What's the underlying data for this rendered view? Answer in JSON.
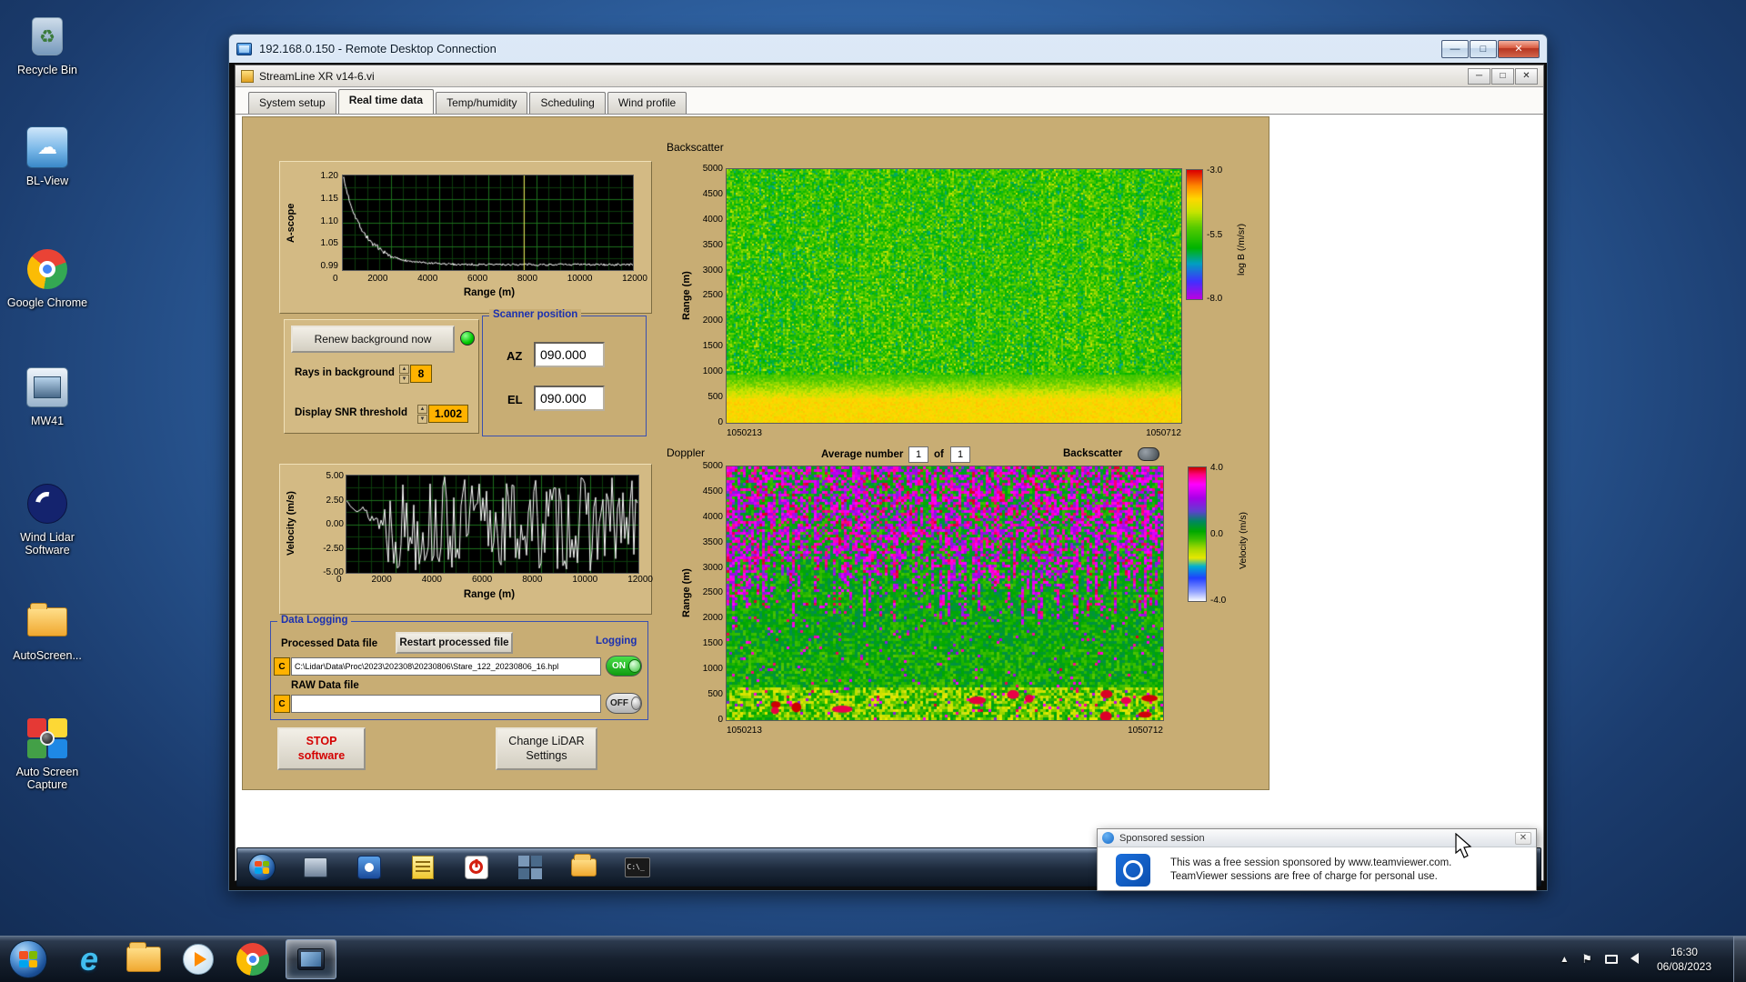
{
  "desktop": {
    "icons": [
      {
        "label": "Recycle Bin"
      },
      {
        "label": "BL-View"
      },
      {
        "label": "Google Chrome"
      },
      {
        "label": "MW41"
      },
      {
        "label": "Wind Lidar Software"
      },
      {
        "label": "AutoScreen..."
      },
      {
        "label": "Auto Screen Capture"
      }
    ]
  },
  "rdp": {
    "title": "192.168.0.150 - Remote Desktop Connection"
  },
  "app": {
    "title": "StreamLine XR v14-6.vi",
    "tabs": [
      "System setup",
      "Real time data",
      "Temp/humidity",
      "Scheduling",
      "Wind profile"
    ],
    "active_tab": "Real time data"
  },
  "panel": {
    "renew_button": "Renew background now",
    "rays_label": "Rays in background",
    "rays_value": "8",
    "snr_label": "Display SNR threshold",
    "snr_value": "1.002",
    "scanner": {
      "title": "Scanner position",
      "az_label": "AZ",
      "az_value": "090.000",
      "el_label": "EL",
      "el_value": "090.000"
    },
    "doppler_bar": {
      "avg_label": "Average number",
      "avg_value": "1",
      "of_label": "of",
      "of_value": "1",
      "backscatter_label": "Backscatter"
    },
    "logging": {
      "title": "Data Logging",
      "processed_label": "Processed Data file",
      "restart_button": "Restart processed file",
      "logging_label": "Logging",
      "drive": "C",
      "processed_path": "C:\\Lidar\\Data\\Proc\\2023\\202308\\20230806\\Stare_122_20230806_16.hpl",
      "on": "ON",
      "raw_label": "RAW Data file",
      "raw_path": "",
      "off": "OFF"
    },
    "stop_line1": "STOP",
    "stop_line2": "software",
    "settings_line1": "Change LiDAR",
    "settings_line2": "Settings"
  },
  "teamviewer": {
    "title": "Sponsored session",
    "line1": "This was a free session sponsored by www.teamviewer.com.",
    "line2": "TeamViewer sessions are free of charge for personal use."
  },
  "tray": {
    "time": "16:30",
    "date": "06/08/2023"
  },
  "chart_data": [
    {
      "id": "ascope",
      "type": "line",
      "xlabel": "Range (m)",
      "ylabel": "A-scope",
      "xlim": [
        0,
        12000
      ],
      "ylim": [
        0.99,
        1.2
      ],
      "xticks": [
        "0",
        "2000",
        "4000",
        "6000",
        "8000",
        "10000",
        "12000"
      ],
      "yticks": [
        1.2,
        1.15,
        1.1,
        1.05,
        0.99
      ],
      "ytick_labels": [
        "1.20",
        "1.15",
        "1.10",
        "1.05",
        "0.99"
      ],
      "line_color": "#ffffff",
      "cursor_x": 7500,
      "cursor_color": "#f8f860",
      "decay": {
        "start": 1.2,
        "base": 1.002,
        "tau_m": 850,
        "noise": 0.005
      }
    },
    {
      "id": "backscatter",
      "type": "heatmap",
      "title": "Backscatter",
      "ylabel": "Range (m)",
      "ylim": [
        0,
        5000
      ],
      "yticks": [
        "0",
        "500",
        "1000",
        "1500",
        "2000",
        "2500",
        "3000",
        "3500",
        "4000",
        "4500",
        "5000"
      ],
      "x_first": "1050213",
      "x_last": "1050712",
      "colorbar": {
        "label": "log B (/m/sr)",
        "ticks": [
          "-3.0",
          "-5.5",
          "-8.0"
        ],
        "vmin": -8,
        "vmax": -3
      },
      "ramp": [
        [
          -8.0,
          "#c000e0"
        ],
        [
          -7.3,
          "#4030ff"
        ],
        [
          -6.6,
          "#00a0c0"
        ],
        [
          -6.0,
          "#00b400"
        ],
        [
          -5.2,
          "#58cc00"
        ],
        [
          -4.6,
          "#c8e400"
        ],
        [
          -4.1,
          "#ffd800"
        ],
        [
          -3.6,
          "#ff8800"
        ],
        [
          -3.0,
          "#dd0000"
        ]
      ],
      "structure": {
        "surface_value": -4.15,
        "surface_top_m": 500,
        "blend_top_m": 950,
        "bulk_mean": -5.6,
        "bulk_noise": 0.7,
        "speckle_bright": -4.7,
        "speckle_prob": 0.05
      }
    },
    {
      "id": "velocity",
      "type": "line",
      "xlabel": "Range (m)",
      "ylabel": "Velocity (m/s)",
      "xlim": [
        0,
        12000
      ],
      "ylim": [
        -5,
        5
      ],
      "xticks": [
        "0",
        "2000",
        "4000",
        "6000",
        "8000",
        "10000",
        "12000"
      ],
      "yticks": [
        5.0,
        2.5,
        0.0,
        -2.5,
        -5.0
      ],
      "ytick_labels": [
        "5.00",
        "2.50",
        "0.00",
        "-2.50",
        "-5.00"
      ],
      "line_color": "#ffffff",
      "structure": {
        "calm_until_m": 1500,
        "calm_start": 2.4,
        "noise_amp": 4.9
      }
    },
    {
      "id": "doppler",
      "type": "heatmap",
      "title": "Doppler",
      "ylabel": "Range (m)",
      "ylim": [
        0,
        5000
      ],
      "yticks": [
        "0",
        "500",
        "1000",
        "1500",
        "2000",
        "2500",
        "3000",
        "3500",
        "4000",
        "4500",
        "5000"
      ],
      "x_first": "1050213",
      "x_last": "1050712",
      "colorbar": {
        "label": "Velocity (m/s)",
        "ticks": [
          "4.0",
          "0.0",
          "-4.0"
        ],
        "vmin": -4,
        "vmax": 4
      },
      "ramp": [
        [
          -4.0,
          "#ffffff"
        ],
        [
          -3.4,
          "#90a0ff"
        ],
        [
          -2.6,
          "#2040ff"
        ],
        [
          -1.9,
          "#00b0d0"
        ],
        [
          -1.4,
          "#e8e800"
        ],
        [
          -0.8,
          "#a0d800"
        ],
        [
          -0.3,
          "#40c000"
        ],
        [
          0.2,
          "#00a800"
        ],
        [
          0.8,
          "#008860"
        ],
        [
          1.4,
          "#6040d0"
        ],
        [
          2.2,
          "#a800e8"
        ],
        [
          3.0,
          "#ff00ff"
        ],
        [
          3.6,
          "#ff0080"
        ],
        [
          4.0,
          "#cc0000"
        ]
      ],
      "structure": {
        "streak_base_m": 1800,
        "streak_var_m": 1800,
        "surface_top_m": 650,
        "blob_count": 12
      }
    }
  ]
}
